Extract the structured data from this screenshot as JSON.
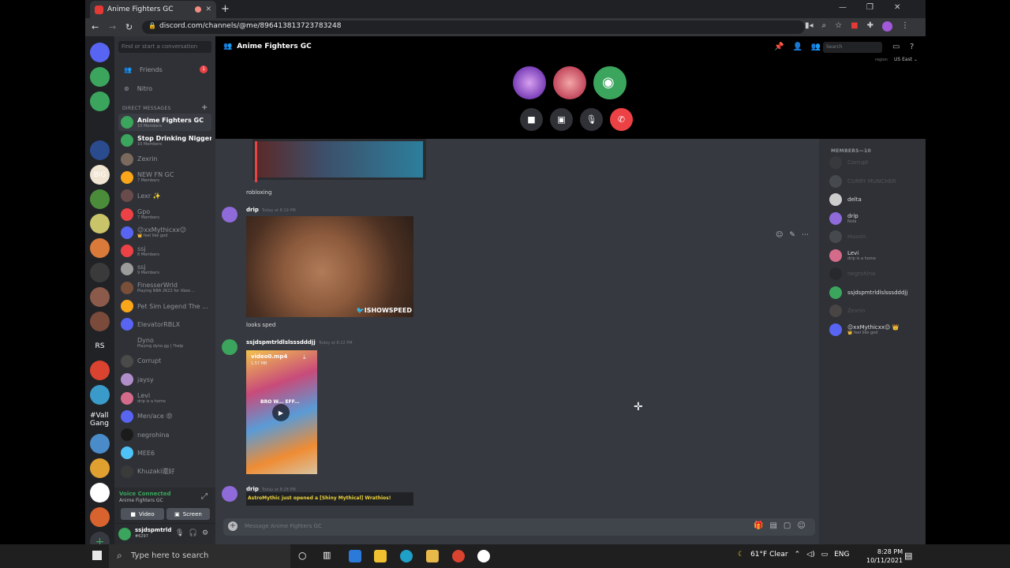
{
  "browser": {
    "tab_title": "Anime Fighters GC",
    "tab_close": "✕",
    "new_tab": "+",
    "url": "discord.com/channels/@me/896413813723783248",
    "window_controls": [
      "—",
      "❐",
      "✕"
    ]
  },
  "sidebar": {
    "find_placeholder": "Find or start a conversation",
    "friends_label": "Friends",
    "friends_badge": "1",
    "nitro_label": "Nitro",
    "dm_header": "DIRECT MESSAGES",
    "dms": [
      {
        "name": "Anime Fighters GC",
        "sub": "10 Members",
        "color": "#3ba55d",
        "active": true
      },
      {
        "name": "Stop Drinking Nigger ...",
        "sub": "10 Members",
        "color": "#3ba55d",
        "bold": true
      },
      {
        "name": "Zexrin",
        "sub": "",
        "color": "#7a6a5e"
      },
      {
        "name": "NEW FN GC",
        "sub": "7 Members",
        "color": "#faa61a"
      },
      {
        "name": "Lexr ✨",
        "sub": "",
        "color": "#6a4b4b"
      },
      {
        "name": "Gpo",
        "sub": "7 Members",
        "color": "#ed4245"
      },
      {
        "name": "😉xxMythicxx😉",
        "sub": "👑 feel like god",
        "color": "#5865f2"
      },
      {
        "name": "ssj",
        "sub": "8 Members",
        "color": "#ed4245"
      },
      {
        "name": "ssj",
        "sub": "9 Members",
        "color": "#9c9c9c"
      },
      {
        "name": "FinesserWrld",
        "sub": "Playing NBA 2K22 for Xbox ...",
        "color": "#7a4f3a"
      },
      {
        "name": "Pet Sim Legend The ...",
        "sub": "",
        "color": "#faa61a"
      },
      {
        "name": "ElevatorRBLX",
        "sub": "",
        "color": "#5865f2"
      },
      {
        "name": "Dyno",
        "sub": "Playing dyno.gg | ?help",
        "color": "#2f3136"
      },
      {
        "name": "Corrupt",
        "sub": "",
        "color": "#4a4a4a"
      },
      {
        "name": "jaysy",
        "sub": "",
        "color": "#b08ec9"
      },
      {
        "name": "Levi",
        "sub": "drip is a homo",
        "color": "#d56b8b"
      },
      {
        "name": "Men/ace 😡",
        "sub": "",
        "color": "#5865f2"
      },
      {
        "name": "negrohina",
        "sub": "",
        "color": "#1b1b1b"
      },
      {
        "name": "MEE6",
        "sub": "",
        "color": "#4fc3f7"
      },
      {
        "name": "Khuzaki還好",
        "sub": "",
        "color": "#3a3a3a"
      }
    ],
    "voice_status": "Voice Connected",
    "voice_channel": "Anime Fighters GC",
    "video_button": "Video",
    "screen_button": "Screen",
    "user_name": "ssjdspmtrld...",
    "user_tag": "#6297"
  },
  "servers": [
    {
      "label": "",
      "badge": "1",
      "color": "#5865f2"
    },
    {
      "label": "",
      "badge": "4",
      "color": "#3ba55d"
    },
    {
      "label": "",
      "badge": "2",
      "color": "#3ba55d"
    },
    {
      "label": "",
      "badge": "",
      "color": "#202225"
    },
    {
      "label": "",
      "badge": "",
      "color": "#2a4b8d"
    },
    {
      "label": "BIG",
      "badge": "",
      "color": "#f0e4d2"
    },
    {
      "label": "",
      "badge": "",
      "color": "#4a8c3a"
    },
    {
      "label": "",
      "badge": "",
      "color": "#c9c46a"
    },
    {
      "label": "",
      "badge": "6",
      "color": "#d97a3a"
    },
    {
      "label": "",
      "badge": "382",
      "color": "#3a3a3a"
    },
    {
      "label": "",
      "badge": "",
      "color": "#8b5a4a"
    },
    {
      "label": "",
      "badge": "304",
      "color": "#7a4a3a"
    },
    {
      "label": "RS",
      "badge": "18",
      "color": "#202225"
    },
    {
      "label": "",
      "badge": "8",
      "color": "#d9432f"
    },
    {
      "label": "",
      "badge": "",
      "color": "#3a9ac9"
    },
    {
      "label": "#Vall Gang",
      "badge": "",
      "color": "#202225"
    },
    {
      "label": "",
      "badge": "54",
      "color": "#4a8cc9"
    },
    {
      "label": "",
      "badge": "101",
      "color": "#e0a030"
    },
    {
      "label": "",
      "badge": "1",
      "color": "#ffffff"
    },
    {
      "label": "",
      "badge": "11",
      "color": "#d9632f"
    }
  ],
  "header": {
    "channel_name": "Anime Fighters GC",
    "search_placeholder": "Search",
    "region_label": "region",
    "region_value": "US East ⌄"
  },
  "messages": {
    "m1_text": "robloxing",
    "m2_author": "drip",
    "m2_time": "Today at 8:19 PM",
    "m2_text": "looks sped",
    "m2_watermark": "🐦ISHOWSPEED",
    "m3_author": "ssjdspmtrldlslsssdddjj",
    "m3_time": "Today at 8:22 PM",
    "m3_file": "video0.mp4",
    "m3_size": "1.57 MB",
    "m3_overlay": "BRO W... EFF...",
    "m4_author": "drip",
    "m4_time": "Today at 8:28 PM",
    "m4_banner": "AstroMythic just opened a [Shiny Mythical] Wrathios!"
  },
  "input": {
    "placeholder": "Message Anime Fighters GC"
  },
  "members": {
    "header": "MEMBERS—10",
    "list": [
      {
        "name": "Corrupt",
        "sub": "",
        "color": "#4a4a4a",
        "off": true
      },
      {
        "name": "CURRY MUNCHER",
        "sub": "",
        "color": "#72767d",
        "off": true
      },
      {
        "name": "delta",
        "sub": "",
        "color": "#ccc",
        "off": false
      },
      {
        "name": "drip",
        "sub": "Nola",
        "color": "#8e6bd9",
        "off": false
      },
      {
        "name": "Hussin",
        "sub": "",
        "color": "#72767d",
        "off": true
      },
      {
        "name": "Levi",
        "sub": "drip is a homo",
        "color": "#d56b8b",
        "off": false
      },
      {
        "name": "negrohina",
        "sub": "",
        "color": "#1b1b1b",
        "off": true
      },
      {
        "name": "ssjdspmtrldlslsssdddjj",
        "sub": "",
        "color": "#3ba55d",
        "off": false
      },
      {
        "name": "Zexrin",
        "sub": "",
        "color": "#7a6a5e",
        "off": true
      },
      {
        "name": "😉xxMythicxx😉 👑",
        "sub": "👑 feel like god",
        "color": "#5865f2",
        "off": false
      }
    ]
  },
  "taskbar": {
    "search_placeholder": "Type here to search",
    "weather": "61°F  Clear",
    "lang": "ENG",
    "time": "8:28 PM",
    "date": "10/11/2021"
  }
}
